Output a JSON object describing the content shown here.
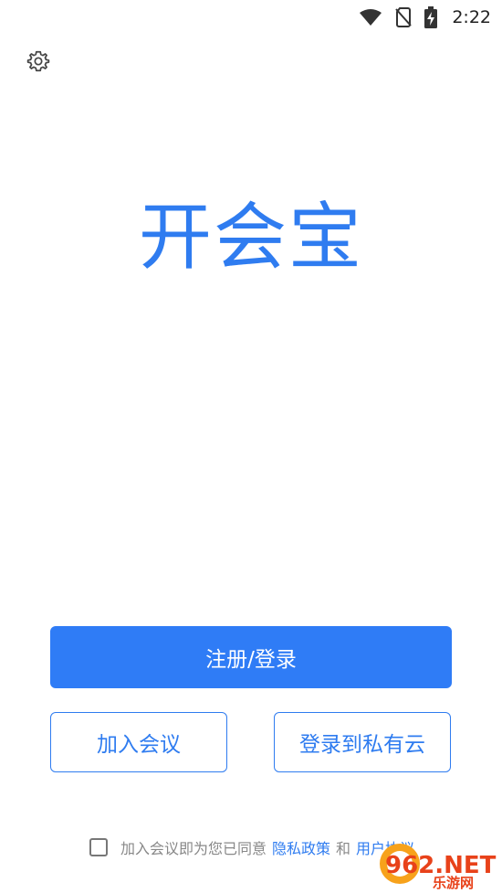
{
  "status_bar": {
    "time": "2:22",
    "icons": [
      "wifi-icon",
      "no-sim-icon",
      "battery-charging-icon"
    ]
  },
  "settings": {
    "icon": "gear-icon"
  },
  "app": {
    "title": "开会宝"
  },
  "actions": {
    "primary": "注册/登录",
    "join_meeting": "加入会议",
    "private_cloud": "登录到私有云"
  },
  "agreement": {
    "prefix": "加入会议即为您已同意",
    "privacy_link": "隐私政策",
    "and": "和",
    "terms_link": "用户协议"
  },
  "watermark": {
    "brand": "962.NET",
    "sub": "乐游网"
  },
  "colors": {
    "accent": "#2f7cf0",
    "button": "#2f7cf6",
    "text_muted": "#888888"
  }
}
